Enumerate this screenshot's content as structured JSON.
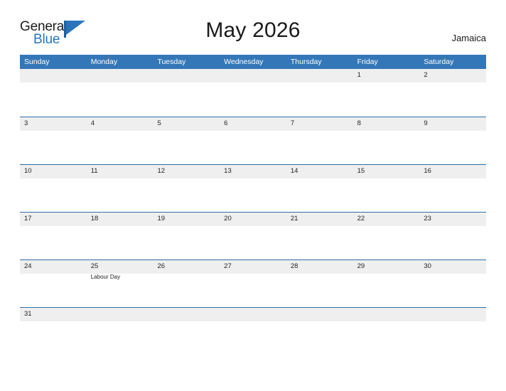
{
  "brand": {
    "word_one": "General",
    "word_two": "Blue",
    "flag_icon": "flag-triangle-icon",
    "color_primary": "#2b74bb",
    "color_dark": "#1a1a1a"
  },
  "header": {
    "title": "May 2026",
    "region": "Jamaica"
  },
  "theme": {
    "header_blue": "#3477b8",
    "row_line_blue": "#2f6da8",
    "band_gray": "#efefef",
    "text_dark": "#1f1f1f",
    "page_bg": "#ffffff"
  },
  "calendar": {
    "month": "May",
    "year": "2026",
    "weekday_headers": [
      "Sunday",
      "Monday",
      "Tuesday",
      "Wednesday",
      "Thursday",
      "Friday",
      "Saturday"
    ],
    "weeks": [
      [
        {
          "day": "",
          "event": ""
        },
        {
          "day": "",
          "event": ""
        },
        {
          "day": "",
          "event": ""
        },
        {
          "day": "",
          "event": ""
        },
        {
          "day": "",
          "event": ""
        },
        {
          "day": "1",
          "event": ""
        },
        {
          "day": "2",
          "event": ""
        }
      ],
      [
        {
          "day": "3",
          "event": ""
        },
        {
          "day": "4",
          "event": ""
        },
        {
          "day": "5",
          "event": ""
        },
        {
          "day": "6",
          "event": ""
        },
        {
          "day": "7",
          "event": ""
        },
        {
          "day": "8",
          "event": ""
        },
        {
          "day": "9",
          "event": ""
        }
      ],
      [
        {
          "day": "10",
          "event": ""
        },
        {
          "day": "11",
          "event": ""
        },
        {
          "day": "12",
          "event": ""
        },
        {
          "day": "13",
          "event": ""
        },
        {
          "day": "14",
          "event": ""
        },
        {
          "day": "15",
          "event": ""
        },
        {
          "day": "16",
          "event": ""
        }
      ],
      [
        {
          "day": "17",
          "event": ""
        },
        {
          "day": "18",
          "event": ""
        },
        {
          "day": "19",
          "event": ""
        },
        {
          "day": "20",
          "event": ""
        },
        {
          "day": "21",
          "event": ""
        },
        {
          "day": "22",
          "event": ""
        },
        {
          "day": "23",
          "event": ""
        }
      ],
      [
        {
          "day": "24",
          "event": ""
        },
        {
          "day": "25",
          "event": "Labour Day"
        },
        {
          "day": "26",
          "event": ""
        },
        {
          "day": "27",
          "event": ""
        },
        {
          "day": "28",
          "event": ""
        },
        {
          "day": "29",
          "event": ""
        },
        {
          "day": "30",
          "event": ""
        }
      ],
      [
        {
          "day": "31",
          "event": ""
        },
        {
          "day": "",
          "event": ""
        },
        {
          "day": "",
          "event": ""
        },
        {
          "day": "",
          "event": ""
        },
        {
          "day": "",
          "event": ""
        },
        {
          "day": "",
          "event": ""
        },
        {
          "day": "",
          "event": ""
        }
      ]
    ]
  }
}
